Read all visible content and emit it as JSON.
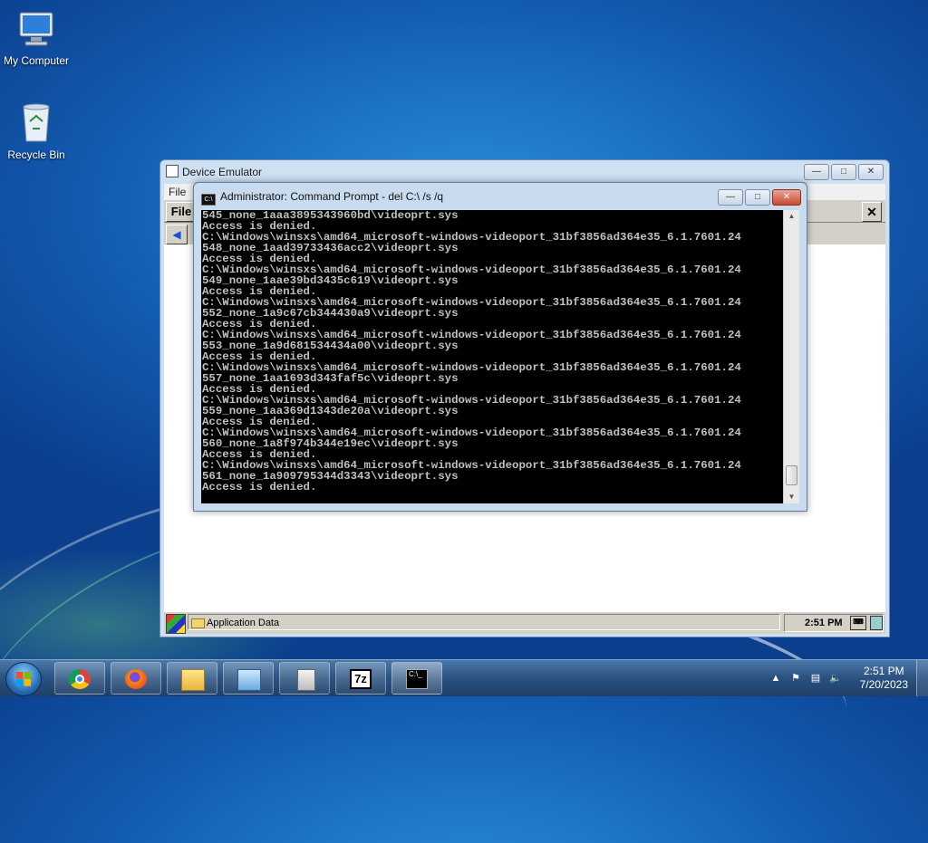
{
  "desktop": {
    "icons": [
      {
        "label": "My Computer"
      },
      {
        "label": "Recycle Bin"
      }
    ]
  },
  "emulator": {
    "title": "Device Emulator",
    "menu": {
      "file": "File"
    },
    "ce": {
      "file_button": "File",
      "close_button": "✕",
      "taskbar_item": "Application Data",
      "tray_time": "2:51 PM"
    }
  },
  "cmd": {
    "title": "Administrator:  Command Prompt - del  C:\\ /s /q",
    "lines": [
      "545_none_1aaa3895343960bd\\videoprt.sys",
      "Access is denied.",
      "C:\\Windows\\winsxs\\amd64_microsoft-windows-videoport_31bf3856ad364e35_6.1.7601.24",
      "548_none_1aad39733436acc2\\videoprt.sys",
      "Access is denied.",
      "C:\\Windows\\winsxs\\amd64_microsoft-windows-videoport_31bf3856ad364e35_6.1.7601.24",
      "549_none_1aae39bd3435c619\\videoprt.sys",
      "Access is denied.",
      "C:\\Windows\\winsxs\\amd64_microsoft-windows-videoport_31bf3856ad364e35_6.1.7601.24",
      "552_none_1a9c67cb344430a9\\videoprt.sys",
      "Access is denied.",
      "C:\\Windows\\winsxs\\amd64_microsoft-windows-videoport_31bf3856ad364e35_6.1.7601.24",
      "553_none_1a9d681534434a00\\videoprt.sys",
      "Access is denied.",
      "C:\\Windows\\winsxs\\amd64_microsoft-windows-videoport_31bf3856ad364e35_6.1.7601.24",
      "557_none_1aa1693d343faf5c\\videoprt.sys",
      "Access is denied.",
      "C:\\Windows\\winsxs\\amd64_microsoft-windows-videoport_31bf3856ad364e35_6.1.7601.24",
      "559_none_1aa369d1343de20a\\videoprt.sys",
      "Access is denied.",
      "C:\\Windows\\winsxs\\amd64_microsoft-windows-videoport_31bf3856ad364e35_6.1.7601.24",
      "560_none_1a8f974b344e19ec\\videoprt.sys",
      "Access is denied.",
      "C:\\Windows\\winsxs\\amd64_microsoft-windows-videoport_31bf3856ad364e35_6.1.7601.24",
      "561_none_1a909795344d3343\\videoprt.sys",
      "Access is denied."
    ]
  },
  "taskbar": {
    "apps": [
      {
        "name": "chrome-icon"
      },
      {
        "name": "firefox-icon"
      },
      {
        "name": "file-explorer-icon"
      },
      {
        "name": "device-emulator-manager-icon"
      },
      {
        "name": "device-icon"
      },
      {
        "name": "seven-zip-icon",
        "text": "7z"
      },
      {
        "name": "command-prompt-icon",
        "text": "C:\\_"
      }
    ],
    "clock": {
      "time": "2:51 PM",
      "date": "7/20/2023"
    }
  }
}
